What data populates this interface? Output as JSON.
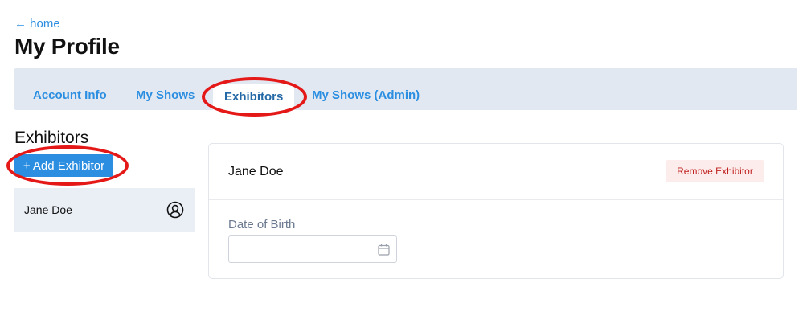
{
  "nav": {
    "back_label": "← home"
  },
  "page": {
    "title": "My Profile"
  },
  "tabs": [
    {
      "label": "Account Info",
      "active": false
    },
    {
      "label": "My Shows",
      "active": false
    },
    {
      "label": "Exhibitors",
      "active": true
    },
    {
      "label": "My Shows (Admin)",
      "active": false
    }
  ],
  "sidebar": {
    "title": "Exhibitors",
    "add_button_label": "+ Add Exhibitor",
    "items": [
      {
        "name": "Jane Doe",
        "icon": "user-circle-icon"
      }
    ]
  },
  "detail": {
    "name": "Jane Doe",
    "remove_button_label": "Remove Exhibitor",
    "fields": [
      {
        "label": "Date of Birth",
        "value": "",
        "icon": "calendar-icon"
      }
    ]
  },
  "colors": {
    "link": "#2b8ee0",
    "tabbar_bg": "#e2e8f2",
    "highlight": "#e51818",
    "remove_bg": "#fdecec",
    "remove_text": "#c0231f"
  }
}
